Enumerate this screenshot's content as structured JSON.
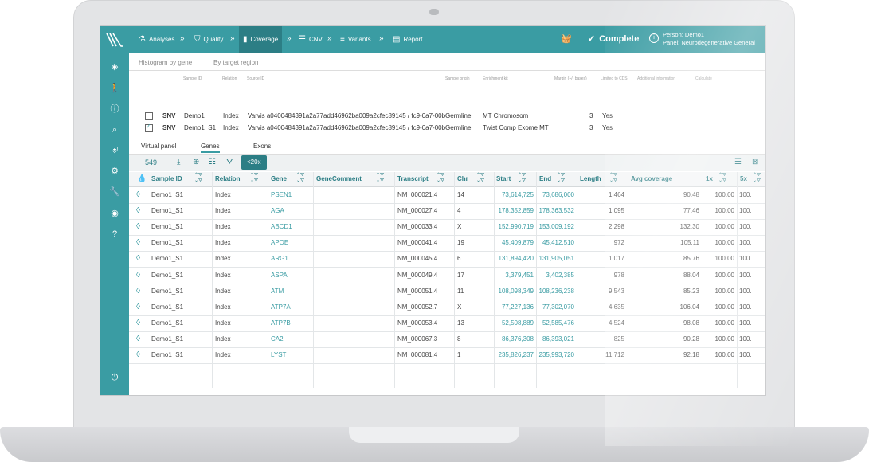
{
  "nav": {
    "items": [
      {
        "label": "Analyses",
        "icon": "flask-icon"
      },
      {
        "label": "Quality",
        "icon": "shield-icon"
      },
      {
        "label": "Coverage",
        "icon": "bar-chart-icon"
      },
      {
        "label": "CNV",
        "icon": "list-icon"
      },
      {
        "label": "Variants",
        "icon": "filter-list-icon"
      },
      {
        "label": "Report",
        "icon": "document-icon"
      }
    ],
    "complete_label": "Complete",
    "person": "Person: Demo1",
    "panel": "Panel: Neurodegenerative General"
  },
  "top_tabs": {
    "histogram": "Histogram by gene",
    "target": "By target region"
  },
  "sample_headers": {
    "sample_id": "Sample ID",
    "relation": "Relation",
    "source_id": "Source ID",
    "sample_origin": "Sample origin",
    "enrichment_kit": "Enrichment kit",
    "margin": "Margin (+/- bases)",
    "limited_cds": "Limited to CDS",
    "additional_info": "Additional information",
    "calculate": "Calculate"
  },
  "samples": [
    {
      "type": "SNV",
      "id": "Demo1",
      "relation": "Index",
      "source": "Varvis a0400484391a2a77add46962ba009a2cfec89145 / fc9-0a7-00b",
      "origin": "Germline",
      "kit": "MT Chromosom",
      "margin": "3",
      "cds": "Yes",
      "checked": false
    },
    {
      "type": "SNV",
      "id": "Demo1_S1",
      "relation": "Index",
      "source": "Varvis a0400484391a2a77add46962ba009a2cfec89145 / fc9-0a7-00b",
      "origin": "Germline",
      "kit": "Twist Comp Exome MT",
      "margin": "3",
      "cds": "Yes",
      "checked": true
    }
  ],
  "sub_tabs": {
    "virtual_panel": "Virtual panel",
    "genes": "Genes",
    "exons": "Exons"
  },
  "toolbar": {
    "count": "549",
    "chip": "<20x"
  },
  "table": {
    "headers": {
      "sample_id": "Sample ID",
      "relation": "Relation",
      "gene": "Gene",
      "gene_comment": "GeneComment",
      "transcript": "Transcript",
      "chr": "Chr",
      "start": "Start",
      "end": "End",
      "length": "Length",
      "avg": "Avg coverage",
      "x1": "1x",
      "x5": "5x"
    },
    "rows": [
      {
        "sample": "Demo1_S1",
        "relation": "Index",
        "gene": "PSEN1",
        "transcript": "NM_000021.4",
        "chr": "14",
        "start": "73,614,725",
        "end": "73,686,000",
        "length": "1,464",
        "avg": "90.48",
        "x1": "100.00",
        "x5": "100."
      },
      {
        "sample": "Demo1_S1",
        "relation": "Index",
        "gene": "AGA",
        "transcript": "NM_000027.4",
        "chr": "4",
        "start": "178,352,859",
        "end": "178,363,532",
        "length": "1,095",
        "avg": "77.46",
        "x1": "100.00",
        "x5": "100."
      },
      {
        "sample": "Demo1_S1",
        "relation": "Index",
        "gene": "ABCD1",
        "transcript": "NM_000033.4",
        "chr": "X",
        "start": "152,990,719",
        "end": "153,009,192",
        "length": "2,298",
        "avg": "132.30",
        "x1": "100.00",
        "x5": "100."
      },
      {
        "sample": "Demo1_S1",
        "relation": "Index",
        "gene": "APOE",
        "transcript": "NM_000041.4",
        "chr": "19",
        "start": "45,409,879",
        "end": "45,412,510",
        "length": "972",
        "avg": "105.11",
        "x1": "100.00",
        "x5": "100."
      },
      {
        "sample": "Demo1_S1",
        "relation": "Index",
        "gene": "ARG1",
        "transcript": "NM_000045.4",
        "chr": "6",
        "start": "131,894,420",
        "end": "131,905,051",
        "length": "1,017",
        "avg": "85.76",
        "x1": "100.00",
        "x5": "100."
      },
      {
        "sample": "Demo1_S1",
        "relation": "Index",
        "gene": "ASPA",
        "transcript": "NM_000049.4",
        "chr": "17",
        "start": "3,379,451",
        "end": "3,402,385",
        "length": "978",
        "avg": "88.04",
        "x1": "100.00",
        "x5": "100."
      },
      {
        "sample": "Demo1_S1",
        "relation": "Index",
        "gene": "ATM",
        "transcript": "NM_000051.4",
        "chr": "11",
        "start": "108,098,349",
        "end": "108,236,238",
        "length": "9,543",
        "avg": "85.23",
        "x1": "100.00",
        "x5": "100."
      },
      {
        "sample": "Demo1_S1",
        "relation": "Index",
        "gene": "ATP7A",
        "transcript": "NM_000052.7",
        "chr": "X",
        "start": "77,227,136",
        "end": "77,302,070",
        "length": "4,635",
        "avg": "106.04",
        "x1": "100.00",
        "x5": "100."
      },
      {
        "sample": "Demo1_S1",
        "relation": "Index",
        "gene": "ATP7B",
        "transcript": "NM_000053.4",
        "chr": "13",
        "start": "52,508,889",
        "end": "52,585,476",
        "length": "4,524",
        "avg": "98.08",
        "x1": "100.00",
        "x5": "100."
      },
      {
        "sample": "Demo1_S1",
        "relation": "Index",
        "gene": "CA2",
        "transcript": "NM_000067.3",
        "chr": "8",
        "start": "86,376,308",
        "end": "86,393,021",
        "length": "825",
        "avg": "90.28",
        "x1": "100.00",
        "x5": "100."
      },
      {
        "sample": "Demo1_S1",
        "relation": "Index",
        "gene": "LYST",
        "transcript": "NM_000081.4",
        "chr": "1",
        "start": "235,826,237",
        "end": "235,993,720",
        "length": "11,712",
        "avg": "92.18",
        "x1": "100.00",
        "x5": "100."
      }
    ]
  },
  "colors": {
    "accent": "#3a9ca3",
    "accent_dark": "#2c7e85"
  }
}
